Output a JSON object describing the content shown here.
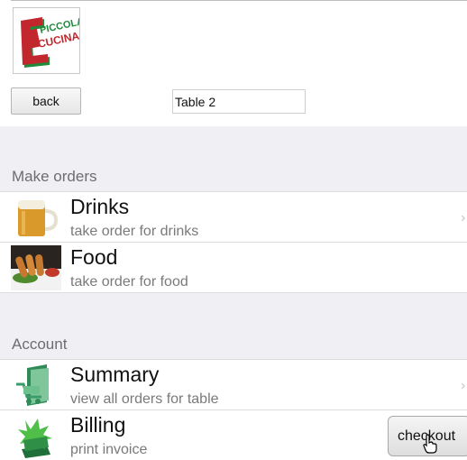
{
  "logo": {
    "line1": "PICCOLA",
    "line2": "CUCINA",
    "brand_red": "#c1272d",
    "brand_green": "#1f8a3a"
  },
  "toolbar": {
    "back_label": "back",
    "table_value": "Table 2"
  },
  "sections": [
    {
      "title": "Make orders"
    },
    {
      "title": "Account"
    }
  ],
  "rows": [
    {
      "title": "Drinks",
      "subtitle": "take order for drinks",
      "icon": "beer-mug-icon"
    },
    {
      "title": "Food",
      "subtitle": "take order for food",
      "icon": "food-plate-icon"
    },
    {
      "title": "Summary",
      "subtitle": "view all orders for table",
      "icon": "cart-document-icon"
    },
    {
      "title": "Billing",
      "subtitle": "print invoice",
      "icon": "invoice-burst-icon"
    }
  ],
  "checkout": {
    "label": "checkout"
  },
  "colors": {
    "section_band": "#efeff4",
    "section_text": "#6d6d72",
    "subtitle_text": "#7a7a7a",
    "chevron": "#c7c7cc"
  }
}
